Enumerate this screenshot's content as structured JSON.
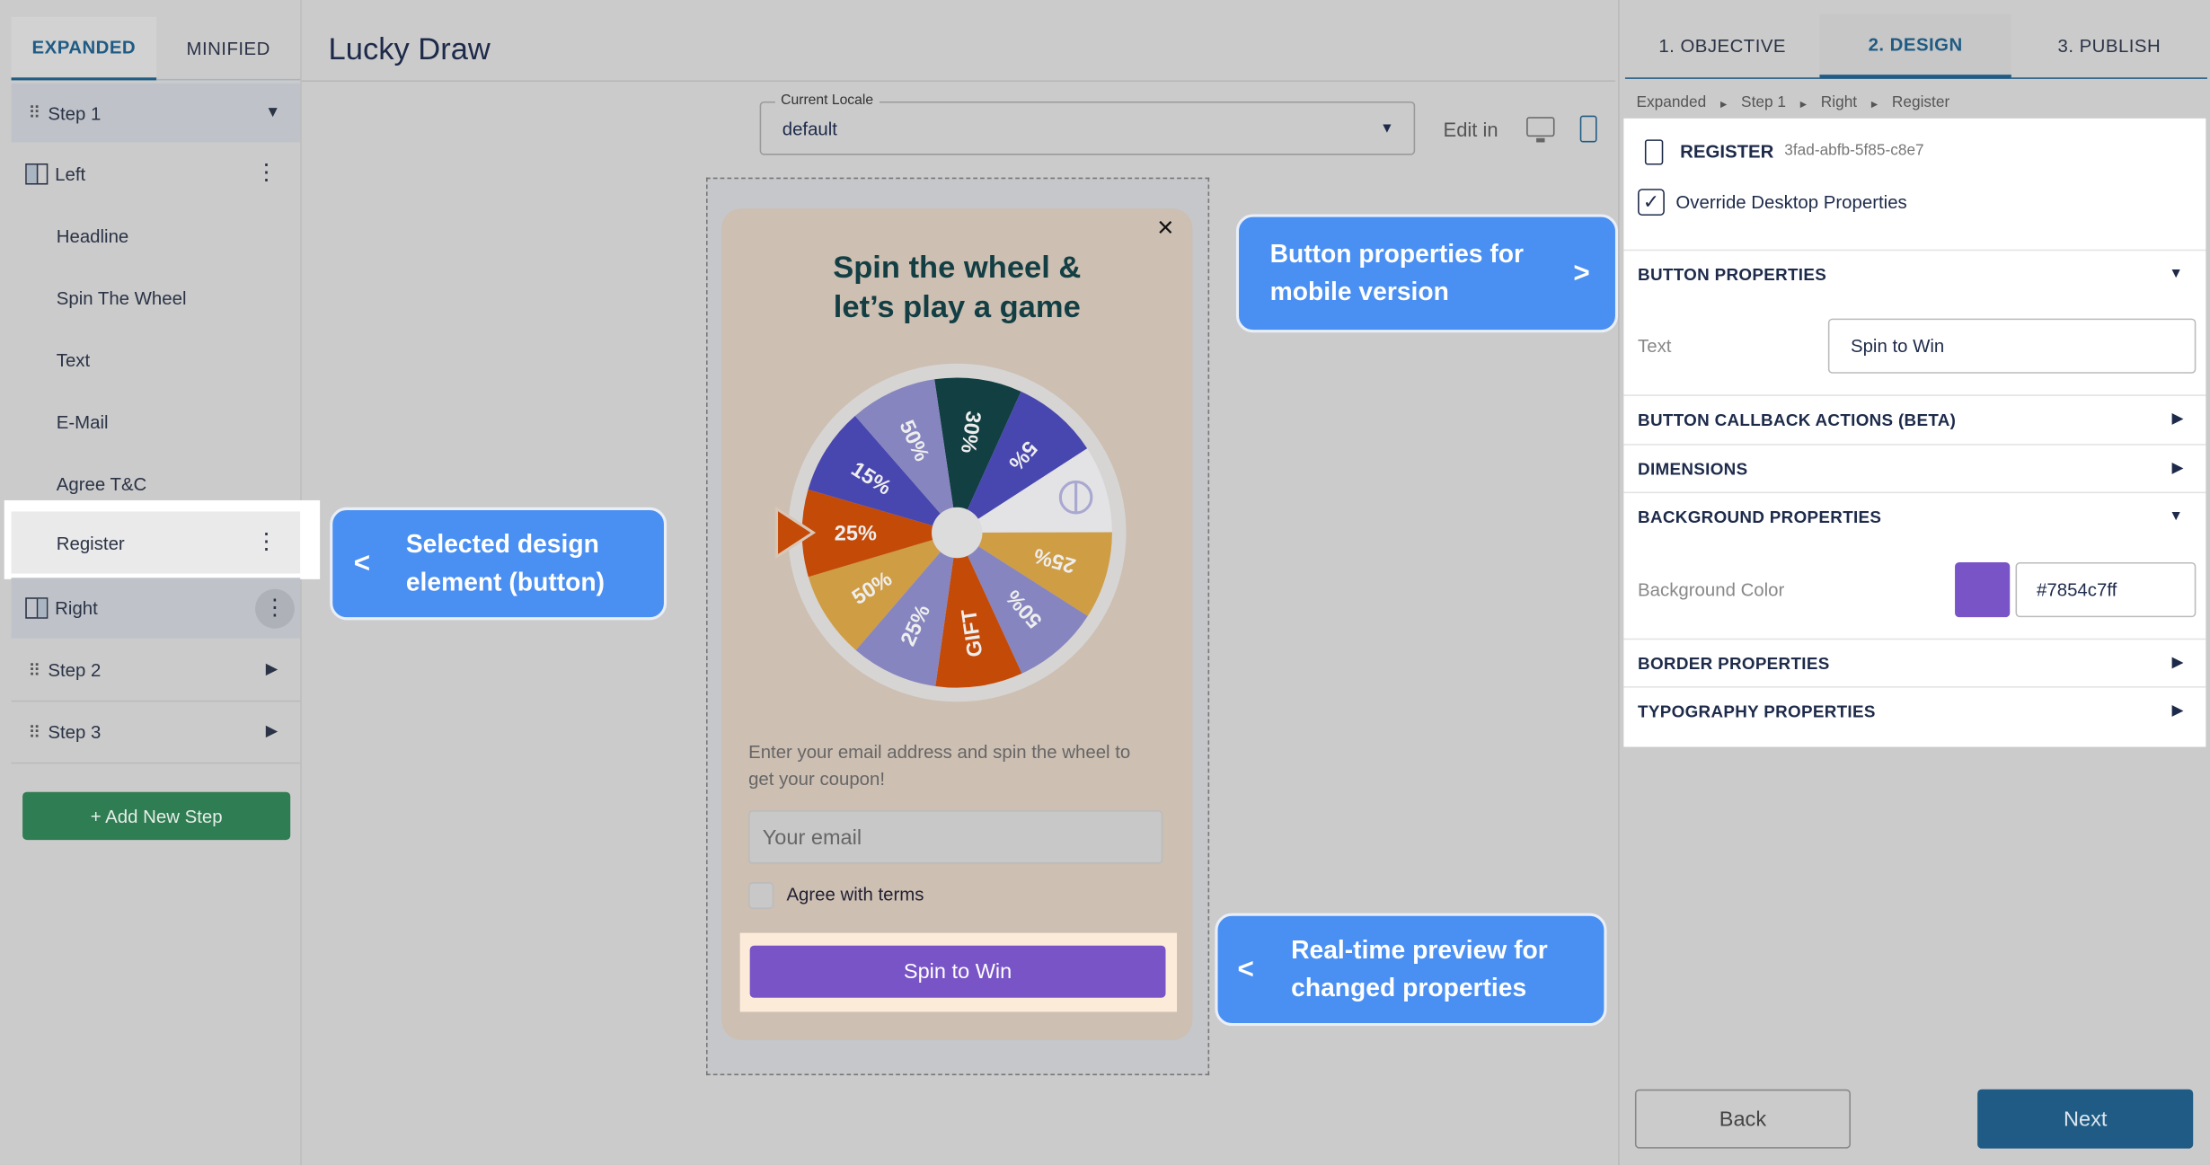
{
  "sidebar": {
    "tabs": [
      {
        "label": "EXPANDED",
        "active": true
      },
      {
        "label": "MINIFIED",
        "active": false
      }
    ],
    "step1": "Step 1",
    "left": "Left",
    "left_items": [
      "Headline",
      "Spin The Wheel",
      "Text",
      "E-Mail",
      "Agree T&C",
      "Register"
    ],
    "right": "Right",
    "step2": "Step 2",
    "step3": "Step 3",
    "add_step": "+ Add New Step"
  },
  "header": {
    "title": "Lucky Draw"
  },
  "locale": {
    "label": "Current Locale",
    "value": "default"
  },
  "edit_in": "Edit in",
  "popup": {
    "close": "×",
    "headline_1": "Spin the wheel &",
    "headline_2": "let’s play a game",
    "wheel": {
      "segments": [
        {
          "label": "30%",
          "color": "#113f42"
        },
        {
          "label": "5%",
          "color": "#4847b0"
        },
        {
          "label": "",
          "color": "#e3e3e6"
        },
        {
          "label": "25%",
          "color": "#cf9d44"
        },
        {
          "label": "50%",
          "color": "#8685bf"
        },
        {
          "label": "GIFT",
          "color": "#c44a08"
        },
        {
          "label": "25%",
          "color": "#8685bf"
        },
        {
          "label": "50%",
          "color": "#cf9d44"
        },
        {
          "label": "25%",
          "color": "#c44a08"
        },
        {
          "label": "15%",
          "color": "#4847b0"
        },
        {
          "label": "50%",
          "color": "#8685bf"
        }
      ]
    },
    "text": "Enter your email address and spin the wheel to get your coupon!",
    "email_placeholder": "Your email",
    "agree": "Agree with terms",
    "button": "Spin to Win"
  },
  "callouts": {
    "mobile": "Button properties for mobile version",
    "mobile_arrow": ">",
    "selected": "Selected design element (button)",
    "selected_arrow": "<",
    "preview": "Real-time preview for changed properties",
    "preview_arrow": "<"
  },
  "right_panel": {
    "tabs": [
      {
        "label": "1. OBJECTIVE"
      },
      {
        "label": "2. DESIGN",
        "active": true
      },
      {
        "label": "3. PUBLISH"
      }
    ],
    "breadcrumb": [
      "Expanded",
      "Step 1",
      "Right",
      "Register"
    ],
    "element_name": "REGISTER",
    "element_id": "3fad-abfb-5f85-c8e7",
    "override": "Override Desktop Properties",
    "override_checked": true,
    "sections": {
      "button": "BUTTON PROPERTIES",
      "text_label": "Text",
      "text_value": "Spin to Win",
      "callback": "BUTTON CALLBACK ACTIONS (BETA)",
      "dimensions": "DIMENSIONS",
      "background": "BACKGROUND PROPERTIES",
      "bg_label": "Background Color",
      "bg_value": "#7854c7ff",
      "bg_color": "#7854c7",
      "border": "BORDER PROPERTIES",
      "typography": "TYPOGRAPHY PROPERTIES"
    },
    "back": "Back",
    "next": "Next"
  },
  "colors": {
    "accent": "#1f5b84",
    "callout": "#4a8ff2",
    "button": "#7854c7"
  }
}
